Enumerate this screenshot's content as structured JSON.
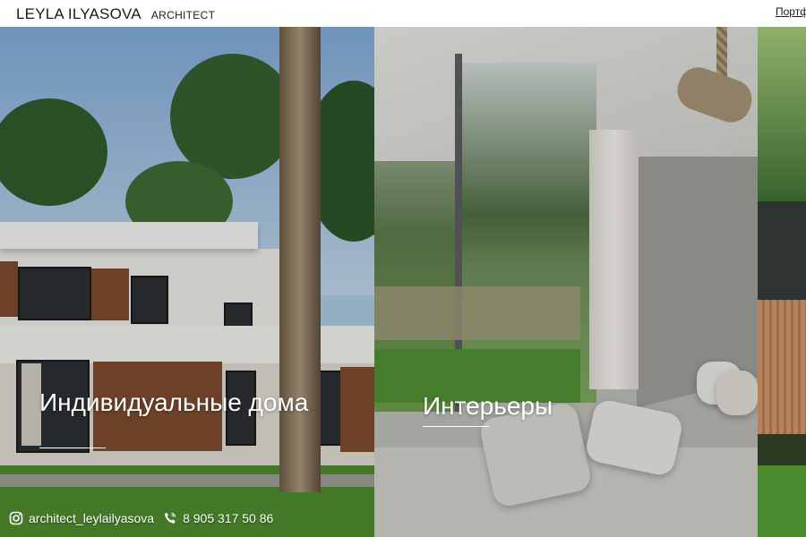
{
  "header": {
    "logo_name": "LEYLA ILYASOVA",
    "logo_sub": "ARCHITECT",
    "nav_portfolio": "Портфолио"
  },
  "panels": [
    {
      "title": "Индивидуальные дома"
    },
    {
      "title": "Интерьеры"
    }
  ],
  "contacts": {
    "instagram": "architect_leylailyasova",
    "phone": "8 905 317 50 86",
    "instagram_icon": "instagram-icon",
    "phone_icon": "phone-icon"
  },
  "colors": {
    "text_dark": "#1c1c1c",
    "overlay_text": "#ffffff"
  }
}
